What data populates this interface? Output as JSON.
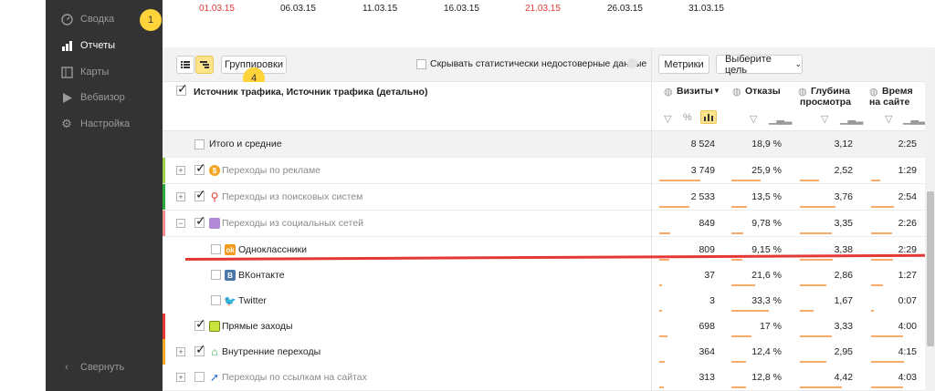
{
  "sidebar": {
    "items": [
      {
        "label": "Сводка",
        "icon": "gauge-icon"
      },
      {
        "label": "Отчеты",
        "icon": "bar-chart-icon"
      },
      {
        "label": "Карты",
        "icon": "map-icon"
      },
      {
        "label": "Вебвизор",
        "icon": "play-icon"
      },
      {
        "label": "Настройка",
        "icon": "gear-icon"
      }
    ],
    "collapse_label": "Свернуть",
    "badge": "1"
  },
  "timeline": {
    "dates": [
      "01.03.15",
      "06.03.15",
      "11.03.15",
      "16.03.15",
      "21.03.15",
      "26.03.15",
      "31.03.15"
    ]
  },
  "toolbar": {
    "groupings_label": "Группировки",
    "badge": "4",
    "hide_unreliable_label": "Скрывать статистически недостоверные данные",
    "metrics_label": "Метрики",
    "goal_label": "Выберите цель"
  },
  "table": {
    "dimension_header": "Источник трафика, Источник трафика (детально)",
    "columns": [
      {
        "l1": "Визиты",
        "l2": ""
      },
      {
        "l1": "Отказы",
        "l2": ""
      },
      {
        "l1": "Глубина",
        "l2": "просмотра"
      },
      {
        "l1": "Время",
        "l2": "на сайте"
      }
    ],
    "pct_symbol": "%",
    "rows": [
      {
        "label": "Итого и средние",
        "visits": "8 524",
        "bounce": "18,9 %",
        "depth": "3,12",
        "time": "2:25"
      },
      {
        "label": "Переходы по рекламе",
        "visits": "3 749",
        "bounce": "25,9 %",
        "depth": "2,52",
        "time": "1:29"
      },
      {
        "label": "Переходы из поисковых систем",
        "visits": "2 533",
        "bounce": "13,5 %",
        "depth": "3,76",
        "time": "2:54"
      },
      {
        "label": "Переходы из социальных сетей",
        "visits": "849",
        "bounce": "9,78 %",
        "depth": "3,35",
        "time": "2:26"
      },
      {
        "label": "Одноклассники",
        "visits": "809",
        "bounce": "9,15 %",
        "depth": "3,38",
        "time": "2:29"
      },
      {
        "label": "ВКонтакте",
        "visits": "37",
        "bounce": "21,6 %",
        "depth": "2,86",
        "time": "1:27"
      },
      {
        "label": "Twitter",
        "visits": "3",
        "bounce": "33,3 %",
        "depth": "1,67",
        "time": "0:07"
      },
      {
        "label": "Прямые заходы",
        "visits": "698",
        "bounce": "17 %",
        "depth": "3,33",
        "time": "4:00"
      },
      {
        "label": "Внутренние переходы",
        "visits": "364",
        "bounce": "12,4 %",
        "depth": "2,95",
        "time": "4:15"
      },
      {
        "label": "Переходы по ссылкам на сайтах",
        "visits": "313",
        "bounce": "12,8 %",
        "depth": "4,42",
        "time": "4:03"
      }
    ]
  },
  "colors": {
    "sidebar_bg": "#333333",
    "accent_yellow": "#ffd33a",
    "red_marker": "#e53935",
    "bar_orange": "#f7ab6b"
  }
}
